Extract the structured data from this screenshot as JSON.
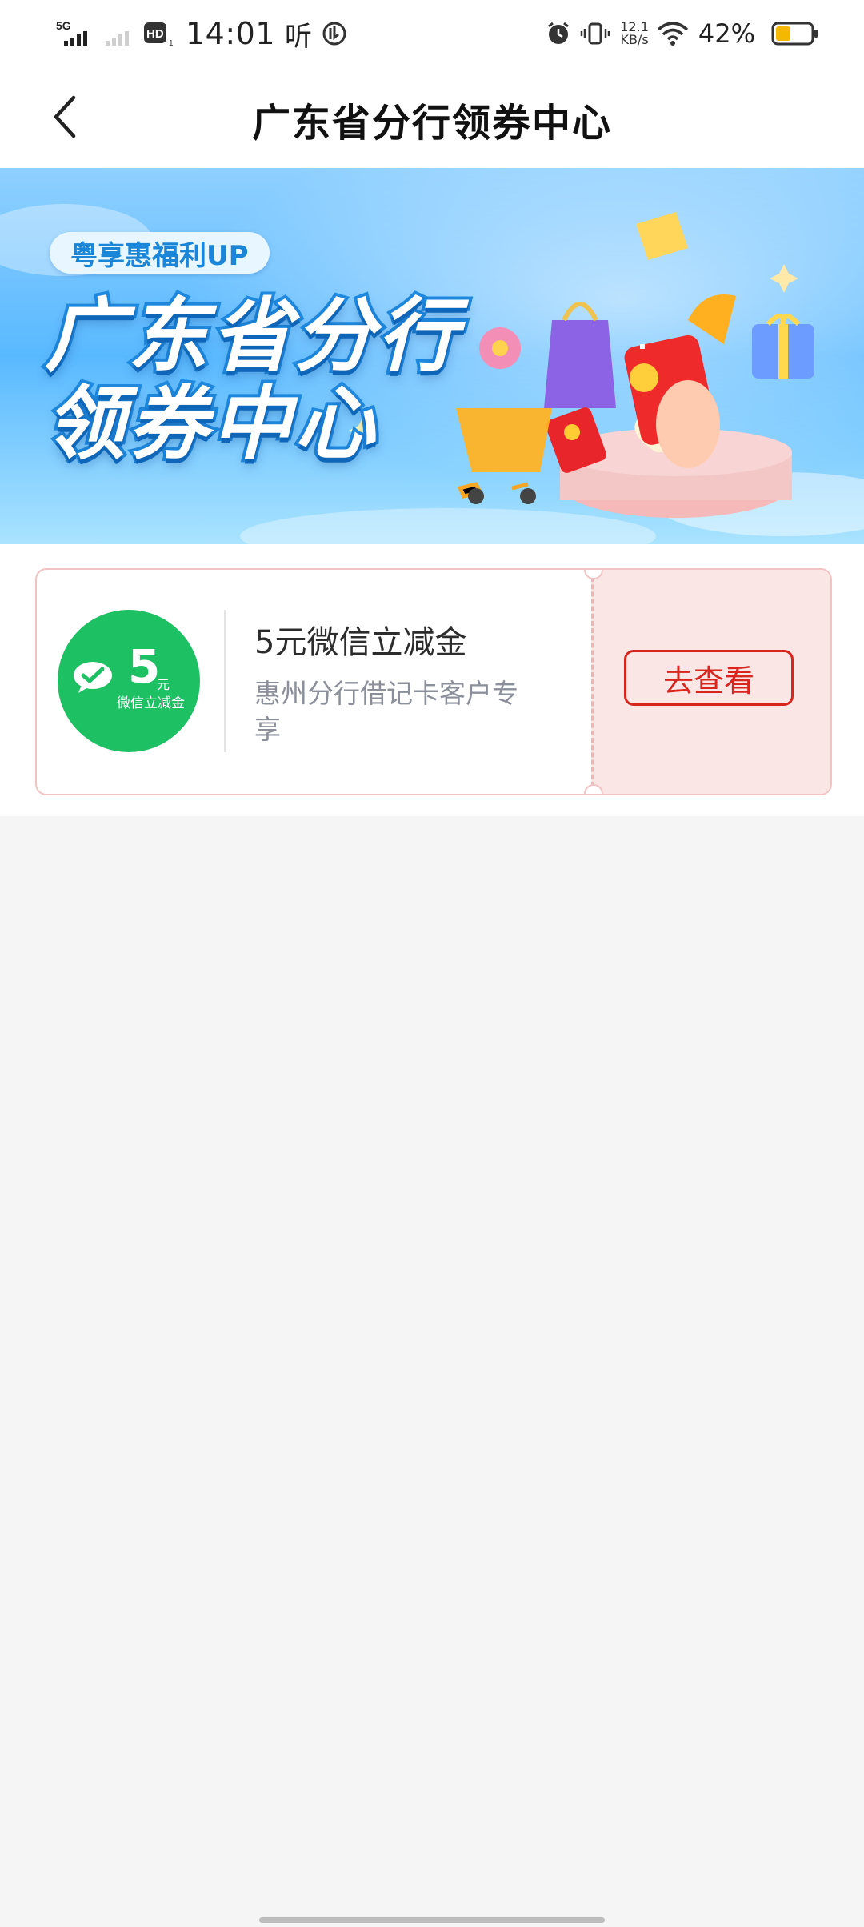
{
  "status_bar": {
    "network": "5G",
    "hd_label": "HD",
    "hd_sub": "1",
    "time": "14:01",
    "listen_glyph": "听",
    "speed_value": "12.1",
    "speed_unit": "KB/s",
    "battery_percent": "42%",
    "battery_level": 0.42,
    "icons": [
      "signal-icon",
      "signal-weak-icon",
      "hd-icon",
      "app-notification-icon",
      "alarm-icon",
      "vibrate-icon",
      "wifi-icon",
      "battery-icon"
    ]
  },
  "header": {
    "title": "广东省分行领券中心",
    "back_icon": "chevron-left-icon"
  },
  "banner": {
    "tag": "粤享惠福利UP",
    "title_line1": "广东省分行",
    "title_line2": "领券中心"
  },
  "coupons": [
    {
      "badge_amount": "5",
      "badge_unit": "元",
      "badge_label": "微信立减金",
      "title": "5元微信立减金",
      "description": "惠州分行借记卡客户专享",
      "action_label": "去查看"
    }
  ],
  "colors": {
    "accent_red": "#d8261f",
    "wechat_green": "#1dc063",
    "coupon_right_bg": "#fbe6e6",
    "page_bg": "#f5f5f5"
  }
}
